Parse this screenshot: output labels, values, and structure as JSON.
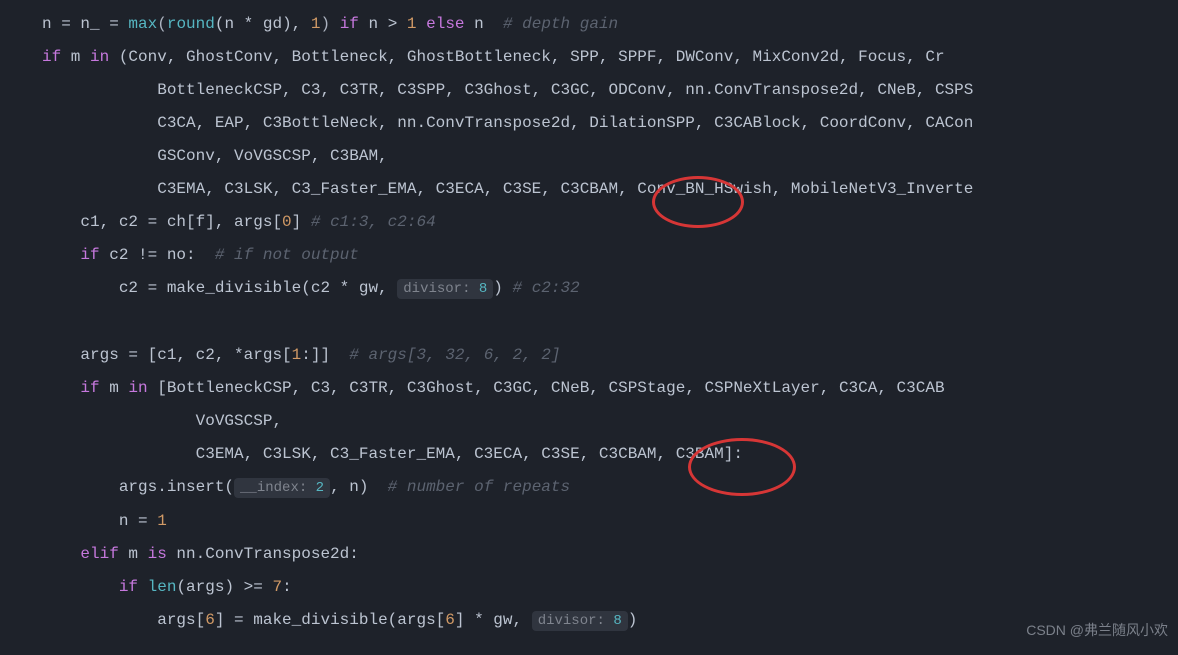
{
  "lines": {
    "l1": {
      "a": "n = n_ = ",
      "max": "max",
      "b": "(",
      "round": "round",
      "c": "(n * gd), ",
      "one": "1",
      "d": ") ",
      "if": "if",
      "e": " n > ",
      "one2": "1",
      "else": " else",
      "f": " n  ",
      "comment": "# depth gain"
    },
    "l2": {
      "if": "if",
      "a": " m ",
      "in": "in",
      "b": " (Conv, GhostConv, Bottleneck, GhostBottleneck, SPP, SPPF, DWConv, MixConv2d, Focus, Cr"
    },
    "l3": {
      "a": "BottleneckCSP, C3, C3TR, C3SPP, C3Ghost, C3GC, ODConv, nn.ConvTranspose2d, CNeB, CSPS"
    },
    "l4": {
      "a": "C3CA, EAP, C3BottleNeck, nn.ConvTranspose2d, DilationSPP, C3CABlock, CoordConv, CACon"
    },
    "l5": {
      "a": "GSConv, VoVGSCSP, C3BAM,"
    },
    "l6": {
      "a": "C3EMA, C3LSK, C3_Faster_EMA, C3ECA, C3SE, C3CBAM, Conv_BN_HSwish, MobileNetV3_Inverte"
    },
    "l7": {
      "a": "c1, c2 = ch[f], args[",
      "zero": "0",
      "b": "] ",
      "comment": "# c1:3, c2:64"
    },
    "l8": {
      "if": "if",
      "a": " c2 != no:  ",
      "comment": "# if not output"
    },
    "l9": {
      "a": "c2 = make_divisible(c2 * gw, ",
      "hint": "divisor:",
      "hv": " 8",
      "b": ") ",
      "comment": "# c2:32"
    },
    "l11": {
      "a": "args = [c1, c2, *args[",
      "one": "1",
      "b": ":]]  ",
      "comment": "# args[3, 32, 6, 2, 2]"
    },
    "l12": {
      "if": "if",
      "a": " m ",
      "in": "in",
      "b": " [BottleneckCSP, C3, C3TR, C3Ghost, C3GC, CNeB, CSPStage, CSPNeXtLayer, C3CA, C3CAB"
    },
    "l13": {
      "a": "VoVGSCSP,"
    },
    "l14": {
      "a": "C3EMA, C3LSK, C3_Faster_EMA, C3ECA, C3SE, C3CBAM, C3BAM]:"
    },
    "l15": {
      "a": "args.insert(",
      "hint": "__index:",
      "hv": " 2",
      "b": ", n)  ",
      "comment": "# number of repeats"
    },
    "l16": {
      "a": "n = ",
      "one": "1"
    },
    "l17": {
      "elif": "elif",
      "a": " m ",
      "is": "is",
      "b": " nn.ConvTranspose2d:"
    },
    "l18": {
      "if": "if",
      "a": " ",
      "len": "len",
      "b": "(args) >= ",
      "seven": "7",
      "c": ":"
    },
    "l19": {
      "a": "args[",
      "six": "6",
      "b": "] = make_divisible(args[",
      "six2": "6",
      "c": "] * gw, ",
      "hint": "divisor:",
      "hv": " 8",
      "d": ")"
    }
  },
  "watermark": "CSDN @弗兰随风小欢"
}
